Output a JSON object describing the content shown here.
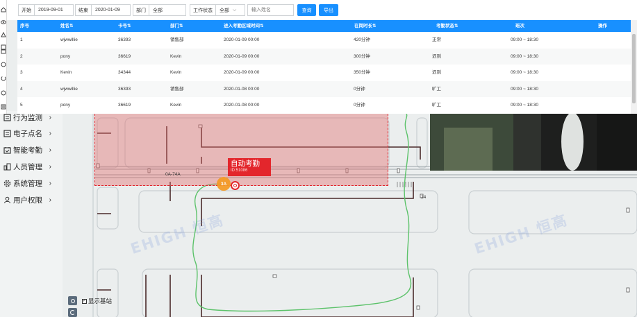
{
  "filters": {
    "start_label": "开始",
    "start_value": "2019-09-01",
    "end_label": "结束",
    "end_value": "2020-01-09",
    "dept_label": "部门",
    "dept_value": "全部",
    "status_label": "工作状态",
    "status_value": "全部",
    "name_placeholder": "输入姓名",
    "query_button": "查询",
    "export_button": "导出"
  },
  "table": {
    "columns": [
      "序号",
      "姓名",
      "卡号",
      "部门",
      "进入考勤区域时间",
      "在岗时长",
      "考勤状态",
      "班次",
      "操作"
    ],
    "rows": [
      [
        "1",
        "wjwwillie",
        "36393",
        "销售部",
        "2020-01-09 00:00",
        "420分钟",
        "正常",
        "09:00 ~ 18:30"
      ],
      [
        "2",
        "pony",
        "36619",
        "Kevin",
        "2020-01-09 00:00",
        "300分钟",
        "迟到",
        "09:00 ~ 18:30"
      ],
      [
        "3",
        "Kevin",
        "34344",
        "Kevin",
        "2020-01-09 00:00",
        "350分钟",
        "迟到",
        "09:00 ~ 18:30"
      ],
      [
        "4",
        "wjwwillie",
        "36393",
        "销售部",
        "2020-01-08 00:00",
        "0分钟",
        "旷工",
        "09:00 ~ 18:30"
      ],
      [
        "5",
        "pony",
        "36619",
        "Kevin",
        "2020-01-08 00:00",
        "0分钟",
        "旷工",
        "09:00 ~ 18:30"
      ]
    ]
  },
  "sidebar": {
    "items": [
      {
        "label": "行为监测",
        "icon": "behavior-icon"
      },
      {
        "label": "电子点名",
        "icon": "rollcall-icon"
      },
      {
        "label": "智能考勤",
        "icon": "attendance-icon"
      },
      {
        "label": "人员管理",
        "icon": "people-icon"
      },
      {
        "label": "系统管理",
        "icon": "gear-icon"
      },
      {
        "label": "用户权限",
        "icon": "user-icon"
      }
    ]
  },
  "map": {
    "zone_tag_title": "自动考勤",
    "zone_tag_id": "ID:51086",
    "person_label": "3A",
    "station_label_1": "0A-74A",
    "station_label_2": "24",
    "show_stations_label": "显示基站",
    "watermark": "EHIGH 恒高"
  },
  "colors": {
    "accent": "#1890ff",
    "zone_border": "#e0242c",
    "zone_fill": "#e26e6e",
    "track": "#5cc26a",
    "marker": "#f59a23"
  }
}
